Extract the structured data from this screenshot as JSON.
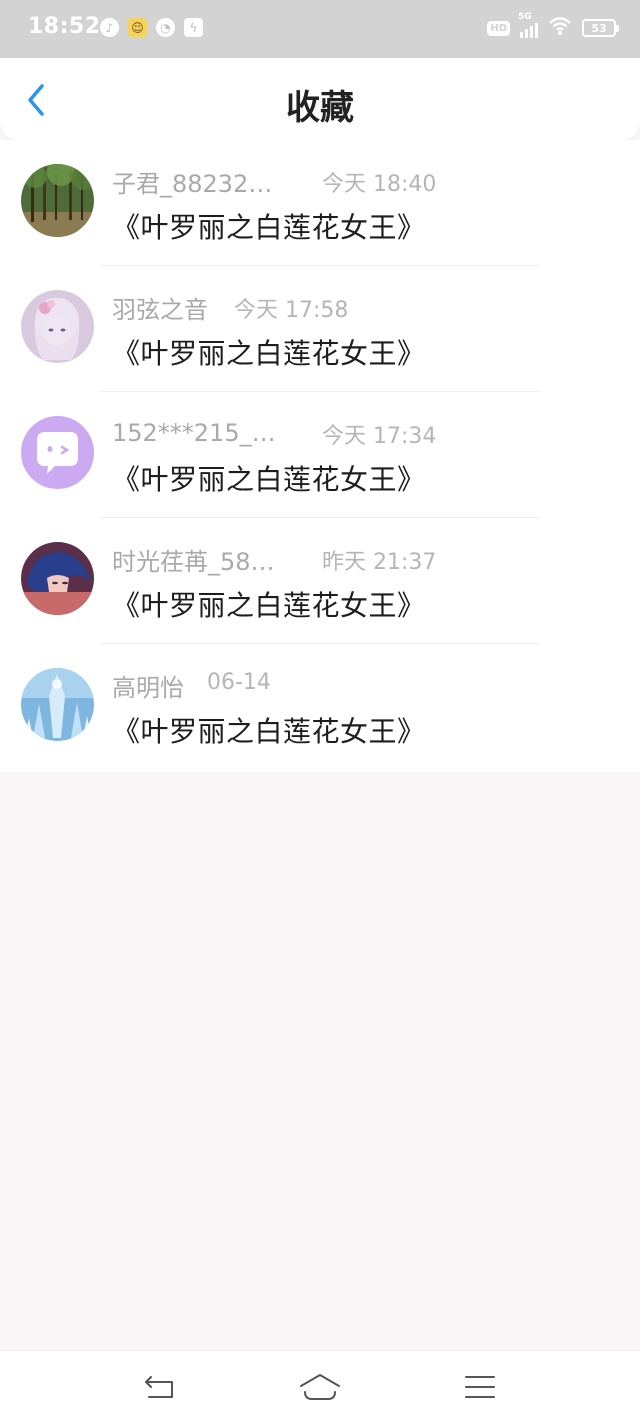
{
  "status_bar": {
    "time": "18:52",
    "left_icons": [
      "music-note-icon",
      "game-app-icon",
      "compass-icon",
      "bolt-icon"
    ],
    "hd": "HD",
    "network": "5G",
    "battery": "53"
  },
  "header": {
    "title": "收藏",
    "back_icon": "chevron-left-icon",
    "accent_color": "#2a94f1"
  },
  "list": {
    "items": [
      {
        "name": "子君_88232…",
        "time": "今天 18:40",
        "title": "《叶罗丽之白莲花女王》",
        "avatar": "forest-avatar"
      },
      {
        "name": "羽弦之音",
        "time": "今天 17:58",
        "title": "《叶罗丽之白莲花女王》",
        "avatar": "anime-girl-avatar"
      },
      {
        "name": "152***215_…",
        "time": "今天 17:34",
        "title": "《叶罗丽之白莲花女王》",
        "avatar": "chat-bubble-avatar"
      },
      {
        "name": "时光荏苒_58…",
        "time": "昨天 21:37",
        "title": "《叶罗丽之白莲花女王》",
        "avatar": "blue-hair-avatar"
      },
      {
        "name": "高明怡",
        "time": "06-14",
        "title": "《叶罗丽之白莲花女王》",
        "avatar": "ice-queen-avatar"
      }
    ]
  },
  "nav_bar": {
    "buttons": [
      "back-arrow-icon",
      "home-icon",
      "menu-icon"
    ]
  }
}
